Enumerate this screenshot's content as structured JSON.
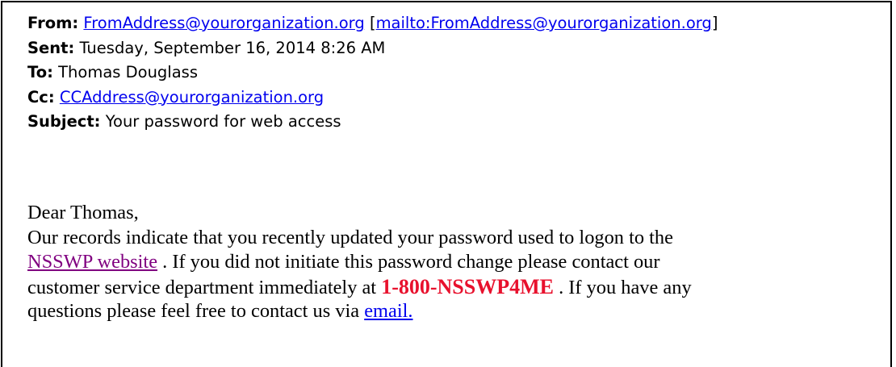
{
  "header": {
    "from_label": "From:",
    "from_address": "FromAddress@yourorganization.org",
    "from_mailto_open": "[",
    "from_mailto": "mailto:FromAddress@yourorganization.org",
    "from_mailto_close": "]",
    "sent_label": "Sent:",
    "sent_value": "Tuesday, September 16, 2014 8:26 AM",
    "to_label": "To:",
    "to_value": "Thomas Douglass",
    "cc_label": "Cc:",
    "cc_address": "CCAddress@yourorganization.org",
    "subject_label": "Subject:",
    "subject_value": "Your password for web access"
  },
  "body": {
    "greeting": "Dear Thomas,",
    "line1": "Our records indicate that you recently updated your password used to logon to the",
    "website_link": "NSSWP website",
    "line2_rest": " . If you did not initiate this password change please contact our",
    "line3_start": "customer service department immediately at ",
    "phone": "1-800-NSSWP4ME",
    "line3_rest": " . If you have any",
    "line4_start": "questions please feel free to contact us via ",
    "email_link": "email."
  },
  "colors": {
    "link": "#0000ee",
    "visited_link": "#800080",
    "phone": "#e8112d",
    "border": "#000000"
  }
}
